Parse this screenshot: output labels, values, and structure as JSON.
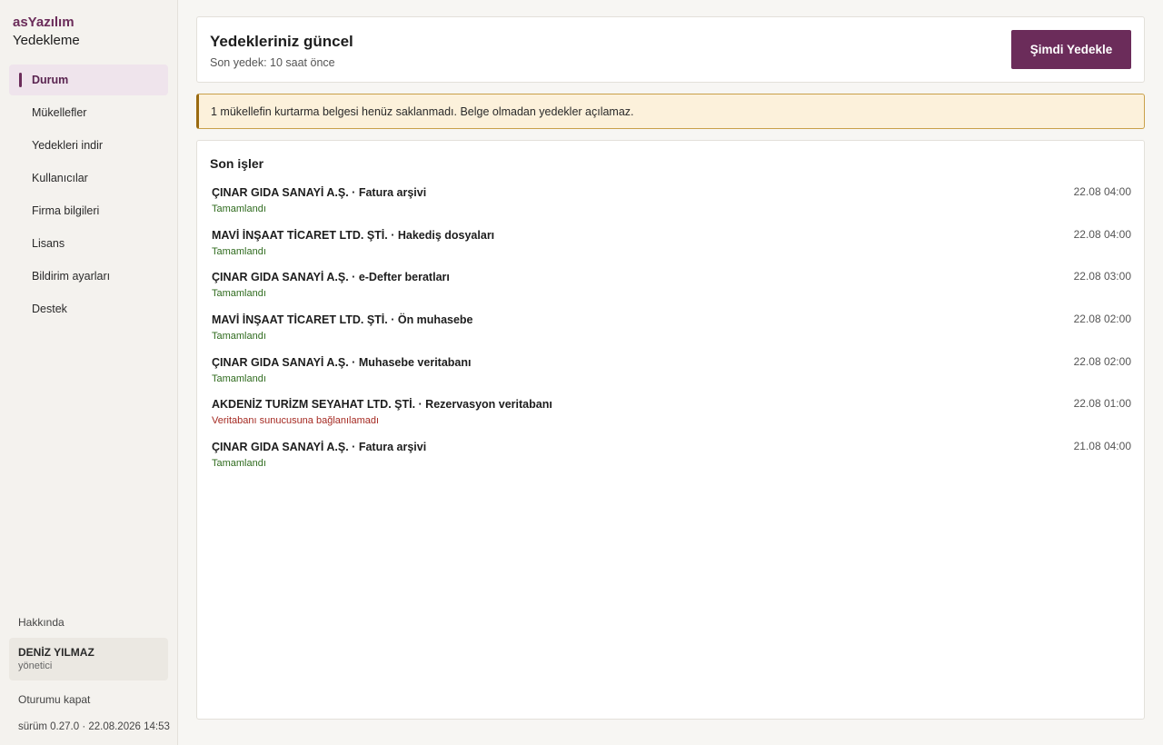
{
  "brand": {
    "name": "asYazılım",
    "product": "Yedekleme"
  },
  "nav": [
    {
      "label": "Durum",
      "active": true
    },
    {
      "label": "Mükellefler"
    },
    {
      "label": "Yedekleri indir"
    },
    {
      "label": "Kullanıcılar"
    },
    {
      "label": "Firma bilgileri"
    },
    {
      "label": "Lisans"
    },
    {
      "label": "Bildirim ayarları"
    },
    {
      "label": "Destek"
    }
  ],
  "sidebar_footer": {
    "about": "Hakkında",
    "user_name": "DENİZ YILMAZ",
    "user_role": "yönetici",
    "logout": "Oturumu kapat",
    "version": "sürüm 0.27.0 · 22.08.2026 14:53"
  },
  "status": {
    "title": "Yedekleriniz güncel",
    "subtitle": "Son yedek: 10 saat önce",
    "button": "Şimdi Yedekle"
  },
  "warning": "1 mükellefin kurtarma belgesi henüz saklanmadı. Belge olmadan yedekler açılamaz.",
  "jobs": {
    "title": "Son işler",
    "items": [
      {
        "name": "ÇINAR GIDA SANAYİ A.Ş. · Fatura arşivi",
        "status": "Tamamlandı",
        "ok": true,
        "time": "22.08 04:00"
      },
      {
        "name": "MAVİ İNŞAAT TİCARET LTD. ŞTİ. · Hakediş dosyaları",
        "status": "Tamamlandı",
        "ok": true,
        "time": "22.08 04:00"
      },
      {
        "name": "ÇINAR GIDA SANAYİ A.Ş. · e-Defter beratları",
        "status": "Tamamlandı",
        "ok": true,
        "time": "22.08 03:00"
      },
      {
        "name": "MAVİ İNŞAAT TİCARET LTD. ŞTİ. · Ön muhasebe",
        "status": "Tamamlandı",
        "ok": true,
        "time": "22.08 02:00"
      },
      {
        "name": "ÇINAR GIDA SANAYİ A.Ş. · Muhasebe veritabanı",
        "status": "Tamamlandı",
        "ok": true,
        "time": "22.08 02:00"
      },
      {
        "name": "AKDENİZ TURİZM SEYAHAT LTD. ŞTİ. · Rezervasyon veritabanı",
        "status": "Veritabanı sunucusuna bağlanılamadı",
        "ok": false,
        "time": "22.08 01:00"
      },
      {
        "name": "ÇINAR GIDA SANAYİ A.Ş. · Fatura arşivi",
        "status": "Tamamlandı",
        "ok": true,
        "time": "21.08 04:00"
      }
    ]
  },
  "colors": {
    "accent": "#6b2c5a",
    "success": "#2f6b1e",
    "error": "#a52a22",
    "warning_bg": "#fcf1db"
  }
}
